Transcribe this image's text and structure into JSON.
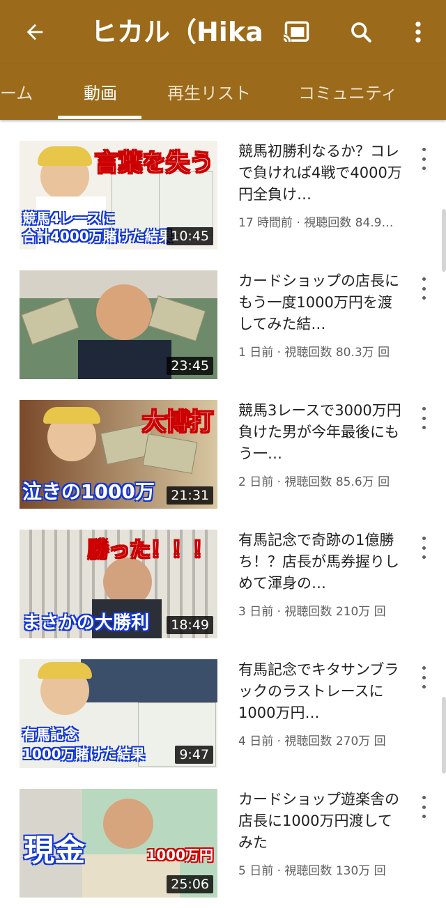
{
  "header": {
    "title": "ヒカル（Hika…",
    "icons": [
      "back-arrow-icon",
      "cast-icon",
      "search-icon",
      "more-vert-icon"
    ]
  },
  "tabs": [
    {
      "label": "ーム",
      "active": false
    },
    {
      "label": "動画",
      "active": true
    },
    {
      "label": "再生リスト",
      "active": false
    },
    {
      "label": "コミュニティ",
      "active": false
    }
  ],
  "videos": [
    {
      "title": "競馬初勝利なるか？コレで負ければ4戦で4000万円全負け…",
      "meta": "17 時間前 · 視聴回数 84.9…",
      "duration": "10:45",
      "thumb_top": "言葉を失う",
      "thumb_bottom": "競馬4レースに\n合計4000万賭けた結果"
    },
    {
      "title": "カードショップの店長にもう一度1000万円を渡してみた結…",
      "meta": "1 日前 · 視聴回数 80.3万 回",
      "duration": "23:45",
      "thumb_top": "",
      "thumb_bottom": ""
    },
    {
      "title": "競馬3レースで3000万円負けた男が今年最後にもう一…",
      "meta": "2 日前 · 視聴回数 85.6万 回",
      "duration": "21:31",
      "thumb_top": "大博打",
      "thumb_bottom": "泣きの1000万"
    },
    {
      "title": "有馬記念で奇跡の1億勝ち！？店長が馬券握りしめて渾身の…",
      "meta": "3 日前 · 視聴回数 210万 回",
      "duration": "18:49",
      "thumb_top": "勝った！！！",
      "thumb_bottom": "まさかの大勝利"
    },
    {
      "title": "有馬記念でキタサンブラックのラストレースに1000万円…",
      "meta": "4 日前 · 視聴回数 270万 回",
      "duration": "9:47",
      "thumb_top": "",
      "thumb_bottom": "有馬記念\n1000万賭けた結果"
    },
    {
      "title": "カードショップ遊楽舎の店長に1000万円渡してみた",
      "meta": "5 日前 · 視聴回数 130万 回",
      "duration": "25:06",
      "thumb_top": "",
      "thumb_bottom": "現金",
      "thumb_extra": "1000万円"
    }
  ],
  "colors": {
    "appbar": "#9b6a1a",
    "title_text": "#212121",
    "meta_text": "#606060"
  }
}
